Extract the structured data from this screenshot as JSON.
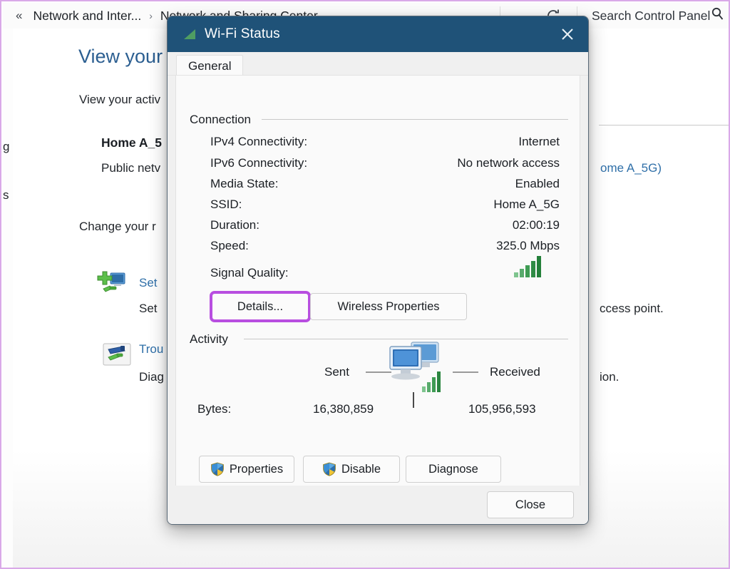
{
  "window": {
    "breadcrumb": {
      "back_glyph": "«",
      "segments": [
        "Network and Inter...",
        "Network and Sharing Center"
      ],
      "separator": "›",
      "chevron_glyph": "⌄"
    },
    "refresh_icon": "refresh-icon",
    "search": {
      "placeholder": "Search Control Panel",
      "icon": "search-icon"
    }
  },
  "content": {
    "page_title": "View your",
    "subtitle": "View your activ",
    "network_name": "Home A_5",
    "network_type": "Public netv",
    "network_link_right": "ome A_5G)",
    "change_settings_heading": "Change your r",
    "items": [
      {
        "link": "Set",
        "description": "Set",
        "description_right": "ccess point.",
        "icon": "setup-connection-icon"
      },
      {
        "link": "Trou",
        "description": "Diag",
        "description_right": "ion.",
        "icon": "troubleshoot-icon"
      }
    ],
    "fragments": [
      "g",
      "s"
    ]
  },
  "dialog": {
    "title": "Wi-Fi Status",
    "title_icon": "wifi-signal-icon",
    "close_icon": "close-icon",
    "tabs": [
      {
        "label": "General",
        "selected": true
      }
    ],
    "connection": {
      "group_label": "Connection",
      "rows": [
        {
          "key": "IPv4 Connectivity:",
          "value": "Internet"
        },
        {
          "key": "IPv6 Connectivity:",
          "value": "No network access"
        },
        {
          "key": "Media State:",
          "value": "Enabled"
        },
        {
          "key": "SSID:",
          "value": "Home A_5G"
        },
        {
          "key": "Duration:",
          "value": "02:00:19"
        },
        {
          "key": "Speed:",
          "value": "325.0 Mbps"
        }
      ],
      "signal_quality_label": "Signal Quality:",
      "signal_quality_icon": "signal-bars-icon",
      "signal_bars_filled": 5,
      "signal_bars_total": 5,
      "buttons": [
        {
          "label": "Details...",
          "focused": true
        },
        {
          "label": "Wireless Properties",
          "focused": false
        }
      ]
    },
    "activity": {
      "group_label": "Activity",
      "sent_label": "Sent",
      "received_label": "Received",
      "bytes_label": "Bytes:",
      "bytes_sent": "16,380,859",
      "bytes_received": "105,956,593",
      "center_icon": "network-computers-icon"
    },
    "action_buttons": [
      {
        "label": "Properties",
        "shield": true
      },
      {
        "label": "Disable",
        "shield": true
      },
      {
        "label": "Diagnose",
        "shield": false
      }
    ],
    "close_button_label": "Close"
  },
  "colors": {
    "titlebar": "#1f5278",
    "focus_outline": "#b84ee0",
    "link": "#2f6fa8",
    "heading": "#2c5f91",
    "signal_green": "#3f9c54",
    "screen_border": "#d9a9e8"
  }
}
